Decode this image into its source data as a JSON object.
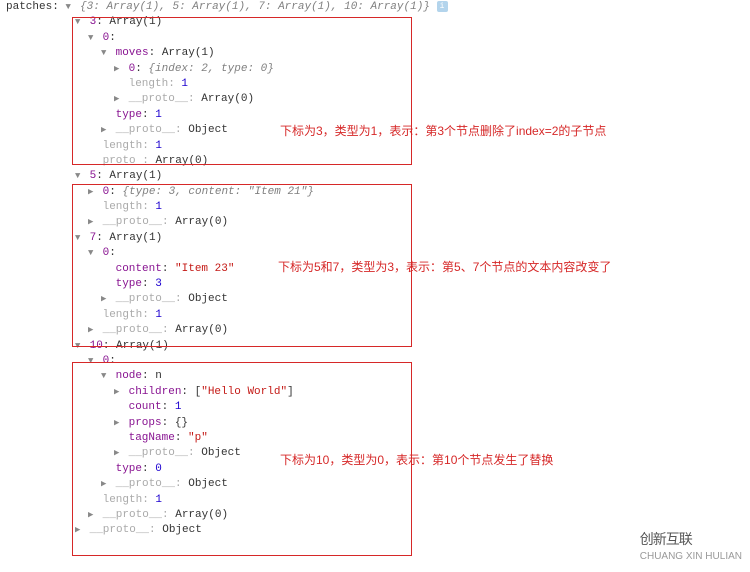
{
  "rootKey": "patches",
  "rootPreview": "{3: Array(1), 5: Array(1), 7: Array(1), 10: Array(1)}",
  "group3": {
    "header": "3",
    "headerType": "Array(1)",
    "idx0": "0",
    "movesKey": "moves",
    "movesType": "Array(1)",
    "moves0Idx": "0",
    "moves0Preview": "{index: 2, type: 0}",
    "lengthKey": "length",
    "lengthVal": "1",
    "protoKey": "__proto__",
    "protoVal": "Array(0)",
    "typeKey": "type",
    "typeVal": "1",
    "protoObj": "Object",
    "outerLengthVal": "1",
    "outerProtoVal": "Array(0)"
  },
  "group5": {
    "header": "5",
    "headerType": "Array(1)",
    "idx0": "0",
    "idx0Preview": "{type: 3, content: \"Item 21\"}",
    "lengthVal": "1",
    "protoVal": "Array(0)"
  },
  "group7": {
    "header": "7",
    "headerType": "Array(1)",
    "idx0": "0",
    "contentKey": "content",
    "contentVal": "\"Item 23\"",
    "typeKey": "type",
    "typeVal": "3",
    "protoObj": "Object",
    "lengthVal": "1",
    "protoVal": "Array(0)"
  },
  "group10": {
    "header": "10",
    "headerType": "Array(1)",
    "idx0": "0",
    "nodeKey": "node",
    "nodeVal": "n",
    "childrenKey": "children",
    "childrenVal": "[\"Hello World\"]",
    "countKey": "count",
    "countVal": "1",
    "propsKey": "props",
    "propsVal": "{}",
    "tagNameKey": "tagName",
    "tagNameVal": "\"p\"",
    "protoObj": "Object",
    "typeKey": "type",
    "typeVal": "0",
    "lengthVal": "1",
    "protoVal": "Array(0)",
    "outerProtoObj": "Object"
  },
  "labels": {
    "length": "length",
    "proto": "__proto__",
    "protoShort": "proto"
  },
  "annotations": {
    "a1": "下标为3，类型为1，表示：第3个节点删除了index=2的子节点",
    "a2": "下标为5和7，类型为3，表示：第5、7个节点的文本内容改变了",
    "a3": "下标为10，类型为0，表示：第10个节点发生了替换"
  },
  "logo": {
    "brand": "创新互联",
    "sub": "CHUANG XIN HULIAN"
  }
}
